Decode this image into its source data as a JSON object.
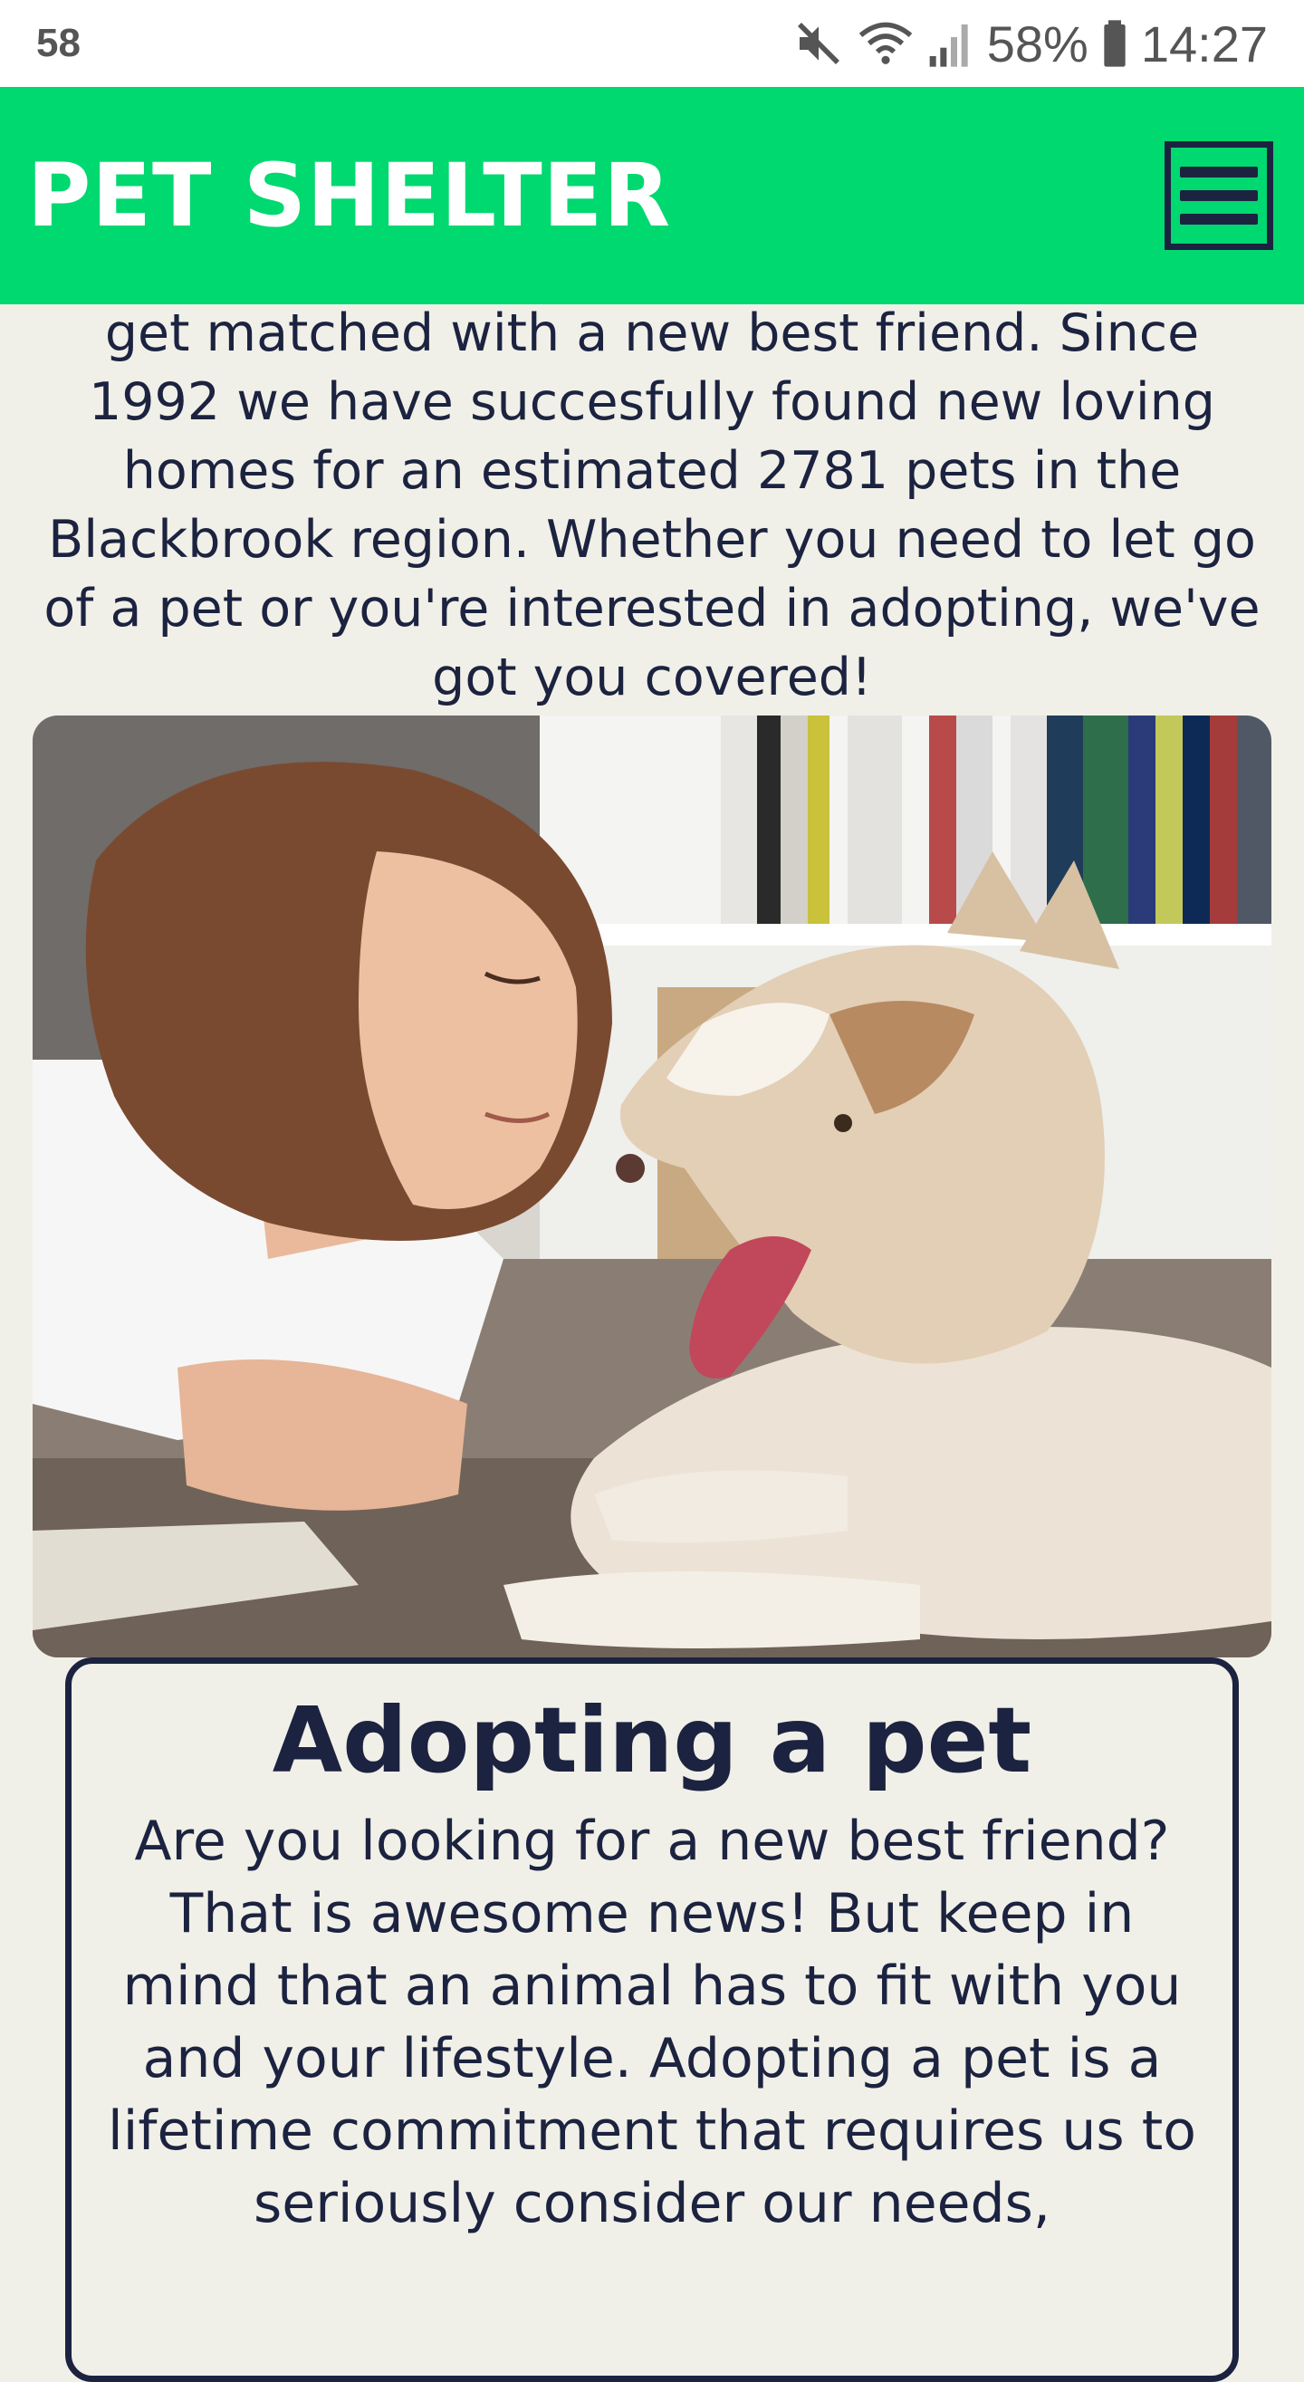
{
  "status_bar": {
    "notification_count": "58",
    "battery_percent": "58%",
    "time": "14:27"
  },
  "header": {
    "brand": "PET SHELTER",
    "menu_icon": "hamburger-menu-icon",
    "colors": {
      "background": "#00d870",
      "brand_text": "#ffffff",
      "menu": "#1c2340"
    }
  },
  "intro": {
    "text": "get matched with a new best friend. Since 1992 we have succesfully found new loving homes for an estimated 2781 pets in the Blackbrook region. Whether you need to let go of a pet or you're interested in adopting, we've got you covered!"
  },
  "adopt_section": {
    "title": "Adopting a pet",
    "text": "Are you looking for a new best friend? That is awesome news! But keep in mind that an animal has to fit with you and your lifestyle. Adopting a pet is a lifetime commitment that requires us to seriously consider our needs,"
  },
  "theme": {
    "page_background": "#f1f0e8",
    "text_color": "#1c2340"
  }
}
